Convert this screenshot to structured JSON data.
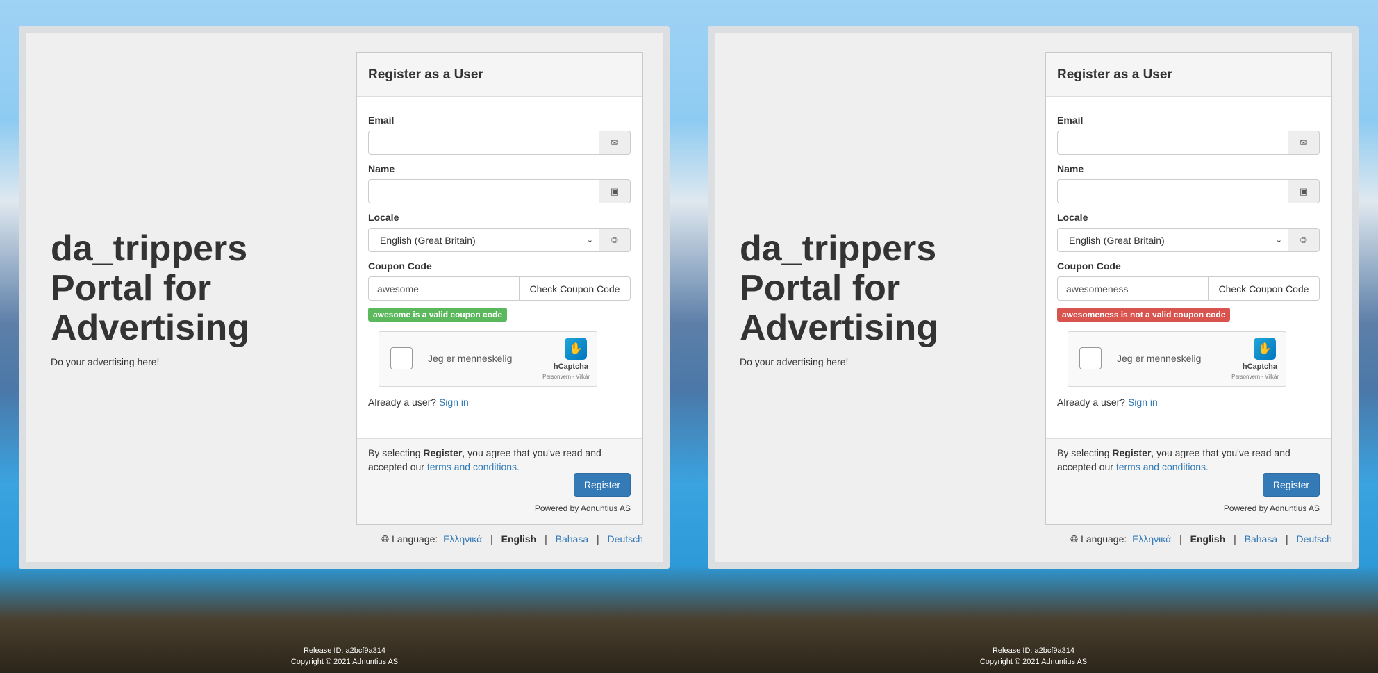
{
  "panels": [
    {
      "hero": {
        "title_line1": "da_trippers",
        "title_line2": "Portal for",
        "title_line3": "Advertising",
        "tagline": "Do your advertising here!"
      },
      "form": {
        "heading": "Register as a User",
        "email_label": "Email",
        "email_value": "",
        "name_label": "Name",
        "name_value": "",
        "locale_label": "Locale",
        "locale_value": "English (Great Britain)",
        "coupon_label": "Coupon Code",
        "coupon_value": "awesome",
        "check_button": "Check Coupon Code",
        "coupon_message": "awesome is a valid coupon code",
        "coupon_status": "valid",
        "coupon_color": "#5cb85c",
        "captcha_text": "Jeg er menneskelig",
        "captcha_brand": "hCaptcha",
        "captcha_terms": "Personvern - Vilkår",
        "already_text": "Already a user?",
        "signin_link": "Sign in",
        "terms_prefix": "By selecting",
        "terms_bold": "Register",
        "terms_middle": ", you agree that you've read and accepted our",
        "terms_link": "terms and conditions.",
        "register_button": "Register",
        "powered_by": "Powered by Adnuntius AS"
      },
      "languages": {
        "label": "Language:",
        "items": [
          "Ελληνικά",
          "English",
          "Bahasa",
          "Deutsch"
        ],
        "current": "English"
      },
      "footer": {
        "release": "Release ID: a2bcf9a314",
        "copyright": "Copyright © 2021 Adnuntius AS"
      }
    },
    {
      "hero": {
        "title_line1": "da_trippers",
        "title_line2": "Portal for",
        "title_line3": "Advertising",
        "tagline": "Do your advertising here!"
      },
      "form": {
        "heading": "Register as a User",
        "email_label": "Email",
        "email_value": "",
        "name_label": "Name",
        "name_value": "",
        "locale_label": "Locale",
        "locale_value": "English (Great Britain)",
        "coupon_label": "Coupon Code",
        "coupon_value": "awesomeness",
        "check_button": "Check Coupon Code",
        "coupon_message": "awesomeness is not a valid coupon code",
        "coupon_status": "invalid",
        "coupon_color": "#d9534f",
        "captcha_text": "Jeg er menneskelig",
        "captcha_brand": "hCaptcha",
        "captcha_terms": "Personvern - Vilkår",
        "already_text": "Already a user?",
        "signin_link": "Sign in",
        "terms_prefix": "By selecting",
        "terms_bold": "Register",
        "terms_middle": ", you agree that you've read and accepted our",
        "terms_link": "terms and conditions.",
        "register_button": "Register",
        "powered_by": "Powered by Adnuntius AS"
      },
      "languages": {
        "label": "Language:",
        "items": [
          "Ελληνικά",
          "English",
          "Bahasa",
          "Deutsch"
        ],
        "current": "English"
      },
      "footer": {
        "release": "Release ID: a2bcf9a314",
        "copyright": "Copyright © 2021 Adnuntius AS"
      }
    }
  ],
  "icons": {
    "email": "envelope-icon",
    "name": "contact-card-icon",
    "locale": "globe-icon",
    "language": "globe-icon",
    "dropdown": "chevron-down-icon"
  },
  "colors": {
    "link": "#337ab7",
    "primary_button": "#337ab7",
    "valid_badge": "#5cb85c",
    "invalid_badge": "#d9534f"
  }
}
